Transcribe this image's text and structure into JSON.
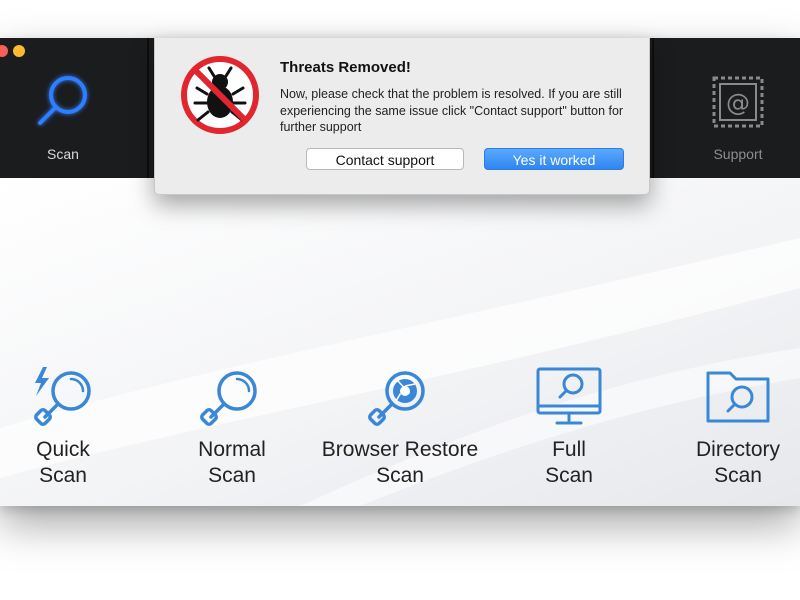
{
  "toolbar": {
    "scan_label": "Scan",
    "support_label": "Support"
  },
  "dialog": {
    "title": "Threats Removed!",
    "message": "Now, please check that the problem is resolved. If you are still experiencing the same issue click \"Contact support\" button for further support",
    "contact_button": "Contact support",
    "yes_button": "Yes it worked"
  },
  "scan_options": [
    {
      "line1": "Quick",
      "line2": "Scan",
      "icon": "quick-scan-icon"
    },
    {
      "line1": "Normal",
      "line2": "Scan",
      "icon": "normal-scan-icon"
    },
    {
      "line1": "Browser Restore",
      "line2": "Scan",
      "icon": "browser-restore-icon"
    },
    {
      "line1": "Full",
      "line2": "Scan",
      "icon": "full-scan-icon"
    },
    {
      "line1": "Directory",
      "line2": "Scan",
      "icon": "directory-scan-icon"
    }
  ],
  "colors": {
    "accent_blue": "#2f86f0",
    "toolbar_bg": "#1b1c1e",
    "icon_blue": "#3a87d8",
    "threat_red": "#e0262e"
  }
}
